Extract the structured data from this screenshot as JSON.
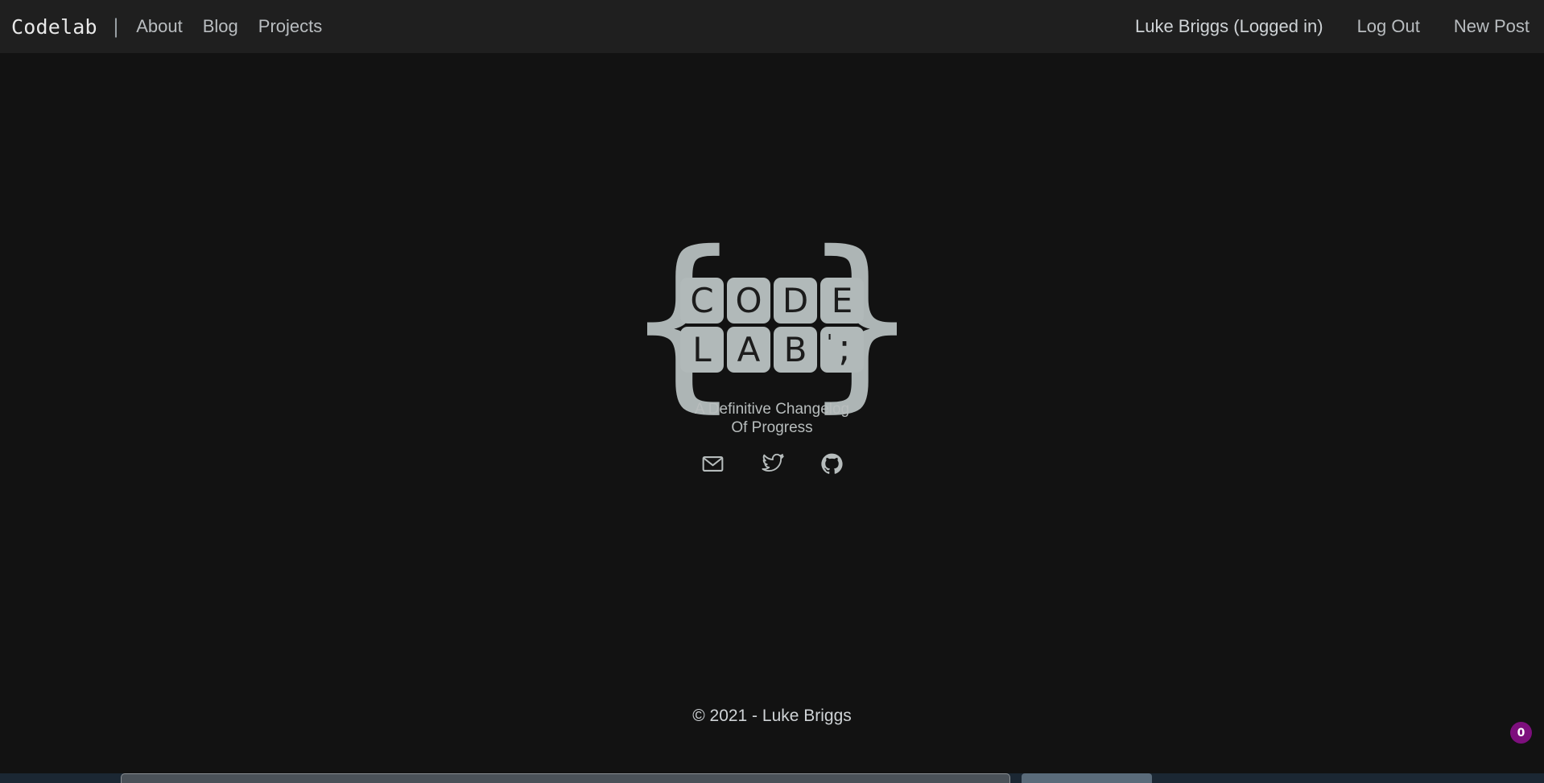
{
  "navbar": {
    "brand": "Codelab",
    "divider": "|",
    "links": [
      {
        "label": "About",
        "name": "nav-link-about"
      },
      {
        "label": "Blog",
        "name": "nav-link-blog"
      },
      {
        "label": "Projects",
        "name": "nav-link-projects"
      }
    ],
    "user_status": "Luke Briggs (Logged in)",
    "log_out": "Log Out",
    "new_post": "New Post"
  },
  "hero": {
    "logo": {
      "brace_left": "{",
      "brace_right": "}",
      "row1": [
        "C",
        "O",
        "D",
        "E"
      ],
      "row2": [
        "L",
        "A",
        "B"
      ],
      "key_quote": "'",
      "key_semicolon": ";"
    },
    "tagline_line1": "A Definitive Changelog",
    "tagline_line2": "Of Progress",
    "socials": [
      {
        "name": "email-icon",
        "label": "Email"
      },
      {
        "name": "twitter-icon",
        "label": "Twitter"
      },
      {
        "name": "github-icon",
        "label": "GitHub"
      }
    ]
  },
  "footer": {
    "copyright": "© 2021 - Luke Briggs"
  },
  "badge": {
    "count": "0",
    "color": "#7d0f7d"
  },
  "colors": {
    "page_background": "#121212",
    "navbar_background": "#1f1f1f",
    "logo_gray": "#b1b9b9",
    "text_light": "#cfd3d6"
  }
}
